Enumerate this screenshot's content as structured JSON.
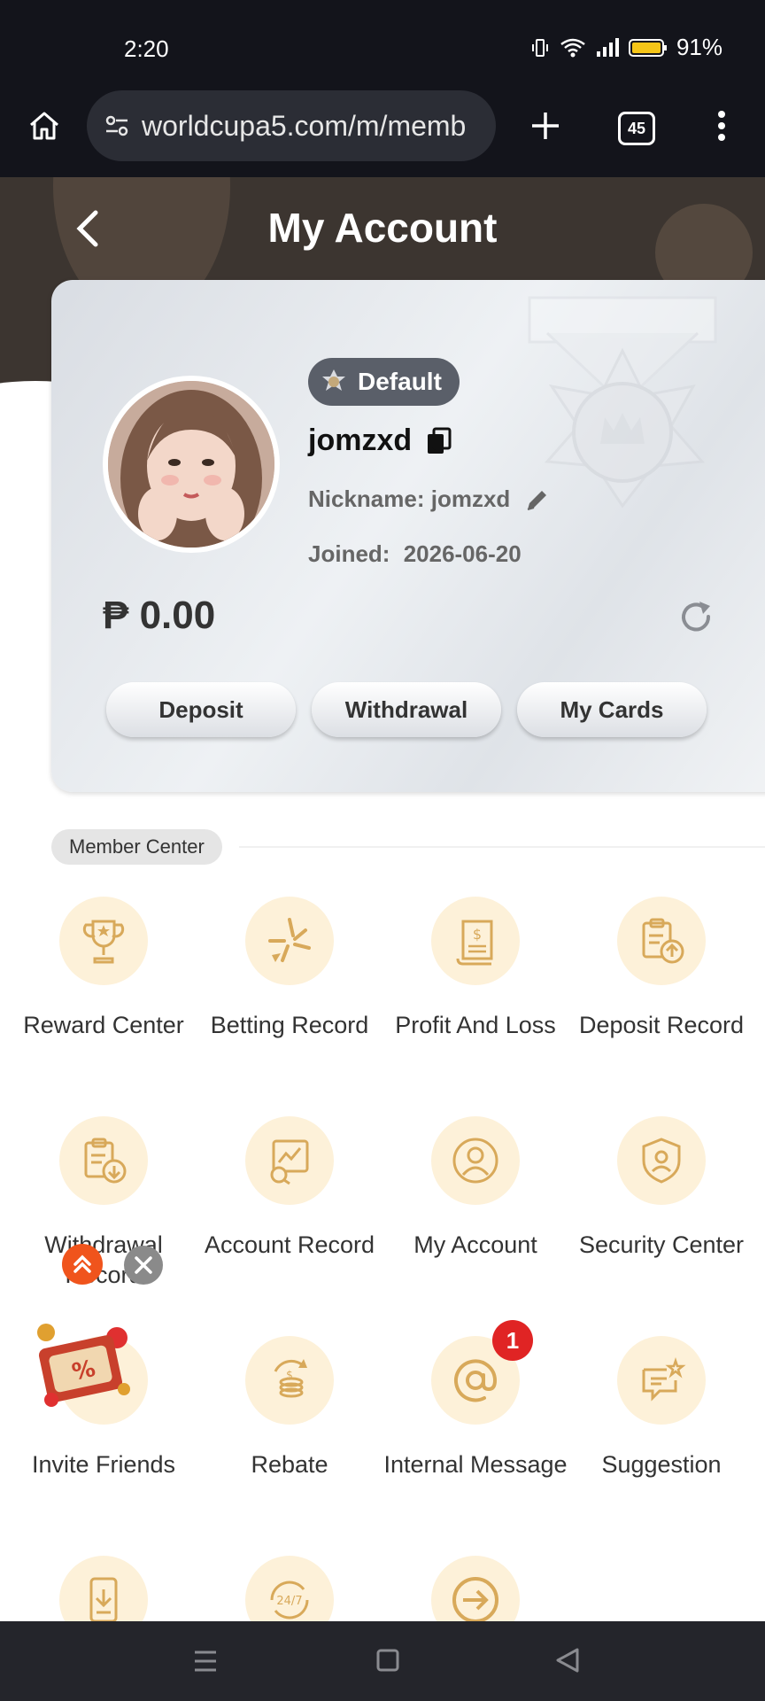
{
  "status_bar": {
    "time": "2:20",
    "battery": "91%"
  },
  "browser": {
    "url": "worldcupa5.com/m/memb",
    "tab_count": "45"
  },
  "header": {
    "title": "My Account"
  },
  "profile": {
    "level_badge": "Default",
    "username": "jomzxd",
    "nickname": "Nickname: jomzxd",
    "joined_label": "Joined:",
    "joined_date": "2026-06-20",
    "balance": "₱ 0.00"
  },
  "actions": {
    "deposit": "Deposit",
    "withdrawal": "Withdrawal",
    "my_cards": "My Cards"
  },
  "member_center": {
    "title": "Member Center",
    "items": [
      {
        "label": "Reward Center",
        "icon": "trophy-icon"
      },
      {
        "label": "Betting Record",
        "icon": "star-icon"
      },
      {
        "label": "Profit And Loss",
        "icon": "receipt-icon"
      },
      {
        "label": "Deposit Record",
        "icon": "clipboard-upload-icon"
      },
      {
        "label": "Withdrawal Record",
        "icon": "clipboard-download-icon"
      },
      {
        "label": "Account Record",
        "icon": "chart-search-icon"
      },
      {
        "label": "My Account",
        "icon": "user-icon"
      },
      {
        "label": "Security Center",
        "icon": "shield-user-icon"
      },
      {
        "label": "Invite Friends",
        "icon": "gift-icon"
      },
      {
        "label": "Rebate",
        "icon": "coins-icon"
      },
      {
        "label": "Internal Message",
        "icon": "at-icon"
      },
      {
        "label": "Suggestion",
        "icon": "chat-star-icon"
      }
    ],
    "internal_message_count": "1"
  },
  "colors": {
    "accent": "#d8a95a",
    "icon_bg": "#fdf1d9",
    "notification": "#e02424",
    "header_bg": "#3c3530"
  }
}
